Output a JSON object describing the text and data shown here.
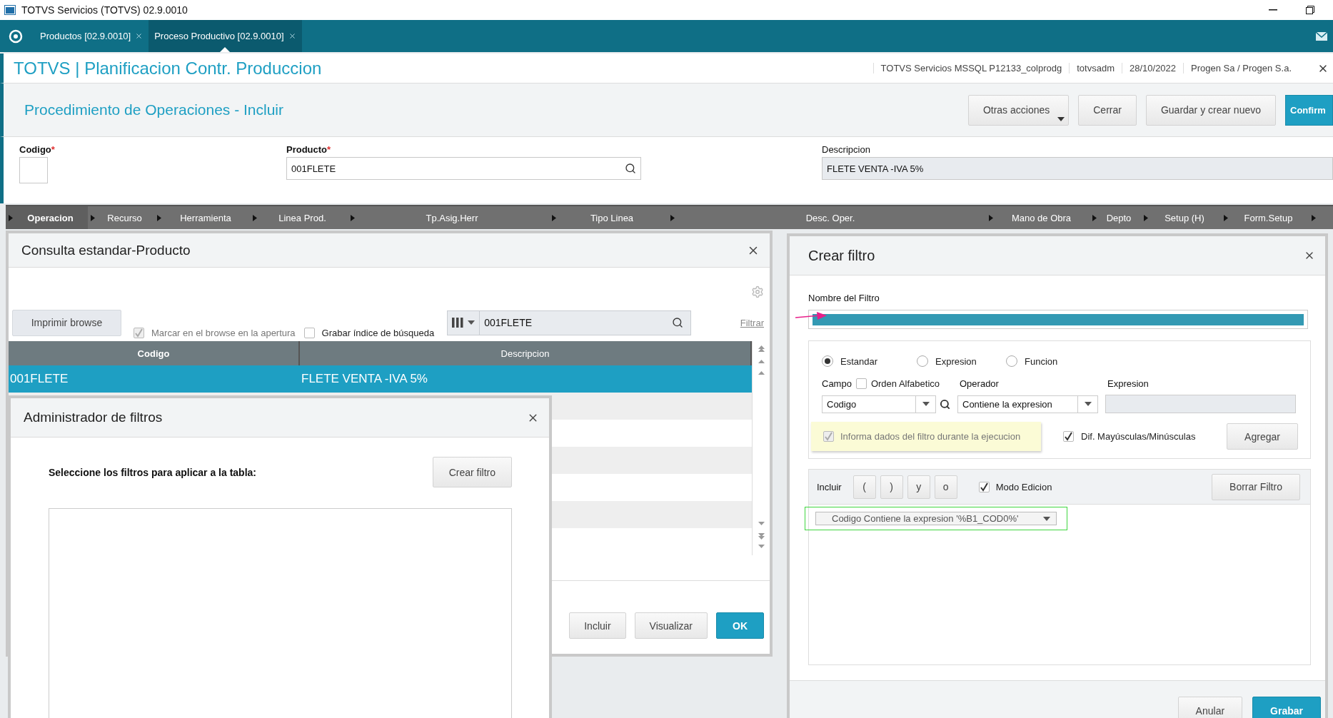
{
  "window": {
    "title": "TOTVS Servicios (TOTVS) 02.9.0010"
  },
  "tabs": [
    {
      "label": "Productos [02.9.0010]",
      "selected": false
    },
    {
      "label": "Proceso Productivo [02.9.0010]",
      "selected": true
    }
  ],
  "app_header": {
    "title": "TOTVS | Planificacion Contr. Produccion",
    "info": [
      "TOTVS Servicios MSSQL P12133_colprodg",
      "totvsadm",
      "28/10/2022",
      "Progen Sa / Progen S.a."
    ]
  },
  "form_header": {
    "title": "Procedimiento de Operaciones - Incluir",
    "buttons": [
      {
        "label": "Otras acciones",
        "kind": "menu"
      },
      {
        "label": "Cerrar",
        "kind": "default"
      },
      {
        "label": "Guardar y crear nuevo",
        "kind": "default"
      },
      {
        "label": "Confirm",
        "kind": "primary"
      }
    ]
  },
  "fields": [
    {
      "label": "Codigo",
      "mark": "*",
      "kind": "short"
    },
    {
      "label": "Producto",
      "mark": "*",
      "value": "001FLETE",
      "kind": "search"
    },
    {
      "label": "Descripcion",
      "value": "FLETE VENTA -IVA 5%",
      "kind": "readonly"
    }
  ],
  "grid_columns": [
    {
      "label": "Operacion",
      "selected": true
    },
    {
      "label": "Recurso",
      "selected": false
    },
    {
      "label": "Herramienta",
      "selected": false
    },
    {
      "label": "Linea Prod.",
      "selected": false
    },
    {
      "label": "Tp.Asig.Herr",
      "selected": false
    },
    {
      "label": "Tipo Linea",
      "selected": false
    },
    {
      "label": "Desc. Oper.",
      "selected": false
    },
    {
      "label": "Mano de Obra",
      "selected": false
    },
    {
      "label": "Depto",
      "selected": false
    },
    {
      "label": "Setup (H)",
      "selected": false
    },
    {
      "label": "Form.Setup",
      "selected": false
    }
  ],
  "consulta": {
    "title": "Consulta estandar-Producto",
    "print_button": "Imprimir browse",
    "checkboxes": [
      {
        "label": "Marcar en el browse en la apertura",
        "checked": true,
        "disabled": true
      },
      {
        "label": "Grabar índice de búsqueda",
        "checked": false,
        "disabled": false
      }
    ],
    "search_value": "001FLETE",
    "filter_link": "Filtrar",
    "columns": [
      "Codigo",
      "Descripcion"
    ],
    "rows": [
      {
        "cells": [
          "001FLETE",
          "FLETE VENTA -IVA 5%"
        ],
        "selected": true
      }
    ],
    "buttons": [
      {
        "label": "Incluir",
        "kind": "default"
      },
      {
        "label": "Visualizar",
        "kind": "default"
      },
      {
        "label": "OK",
        "kind": "primary"
      }
    ]
  },
  "admin_filtros": {
    "title": "Administrador de filtros",
    "instruction": "Seleccione los filtros para aplicar a la tabla:",
    "create_button": "Crear filtro"
  },
  "crear_filtro": {
    "title": "Crear filtro",
    "name_label": "Nombre del Filtro",
    "types": [
      {
        "label": "Estandar",
        "selected": true
      },
      {
        "label": "Expresion",
        "selected": false
      },
      {
        "label": "Funcion",
        "selected": false
      }
    ],
    "campo_label": "Campo",
    "orden": {
      "label": "Orden Alfabetico",
      "checked": false
    },
    "operador_label": "Operador",
    "expresion_label": "Expresion",
    "campo_value": "Codigo",
    "operador_value": "Contiene la expresion",
    "informa": {
      "label": "Informa dados del filtro durante la ejecucion",
      "checked": true
    },
    "dif": {
      "label": "Dif. Mayúsculas/Minúsculas",
      "checked": true
    },
    "agregar": "Agregar",
    "incluir_label": "Incluir",
    "operators": [
      "(",
      ")",
      "y",
      "o"
    ],
    "modo": {
      "label": "Modo Edicion",
      "checked": true
    },
    "borrar": "Borrar Filtro",
    "expressions": [
      "Codigo Contiene la expresion '%B1_COD0%'"
    ],
    "buttons": [
      {
        "label": "Anular",
        "kind": "default"
      },
      {
        "label": "Grabar",
        "kind": "primary"
      }
    ]
  }
}
